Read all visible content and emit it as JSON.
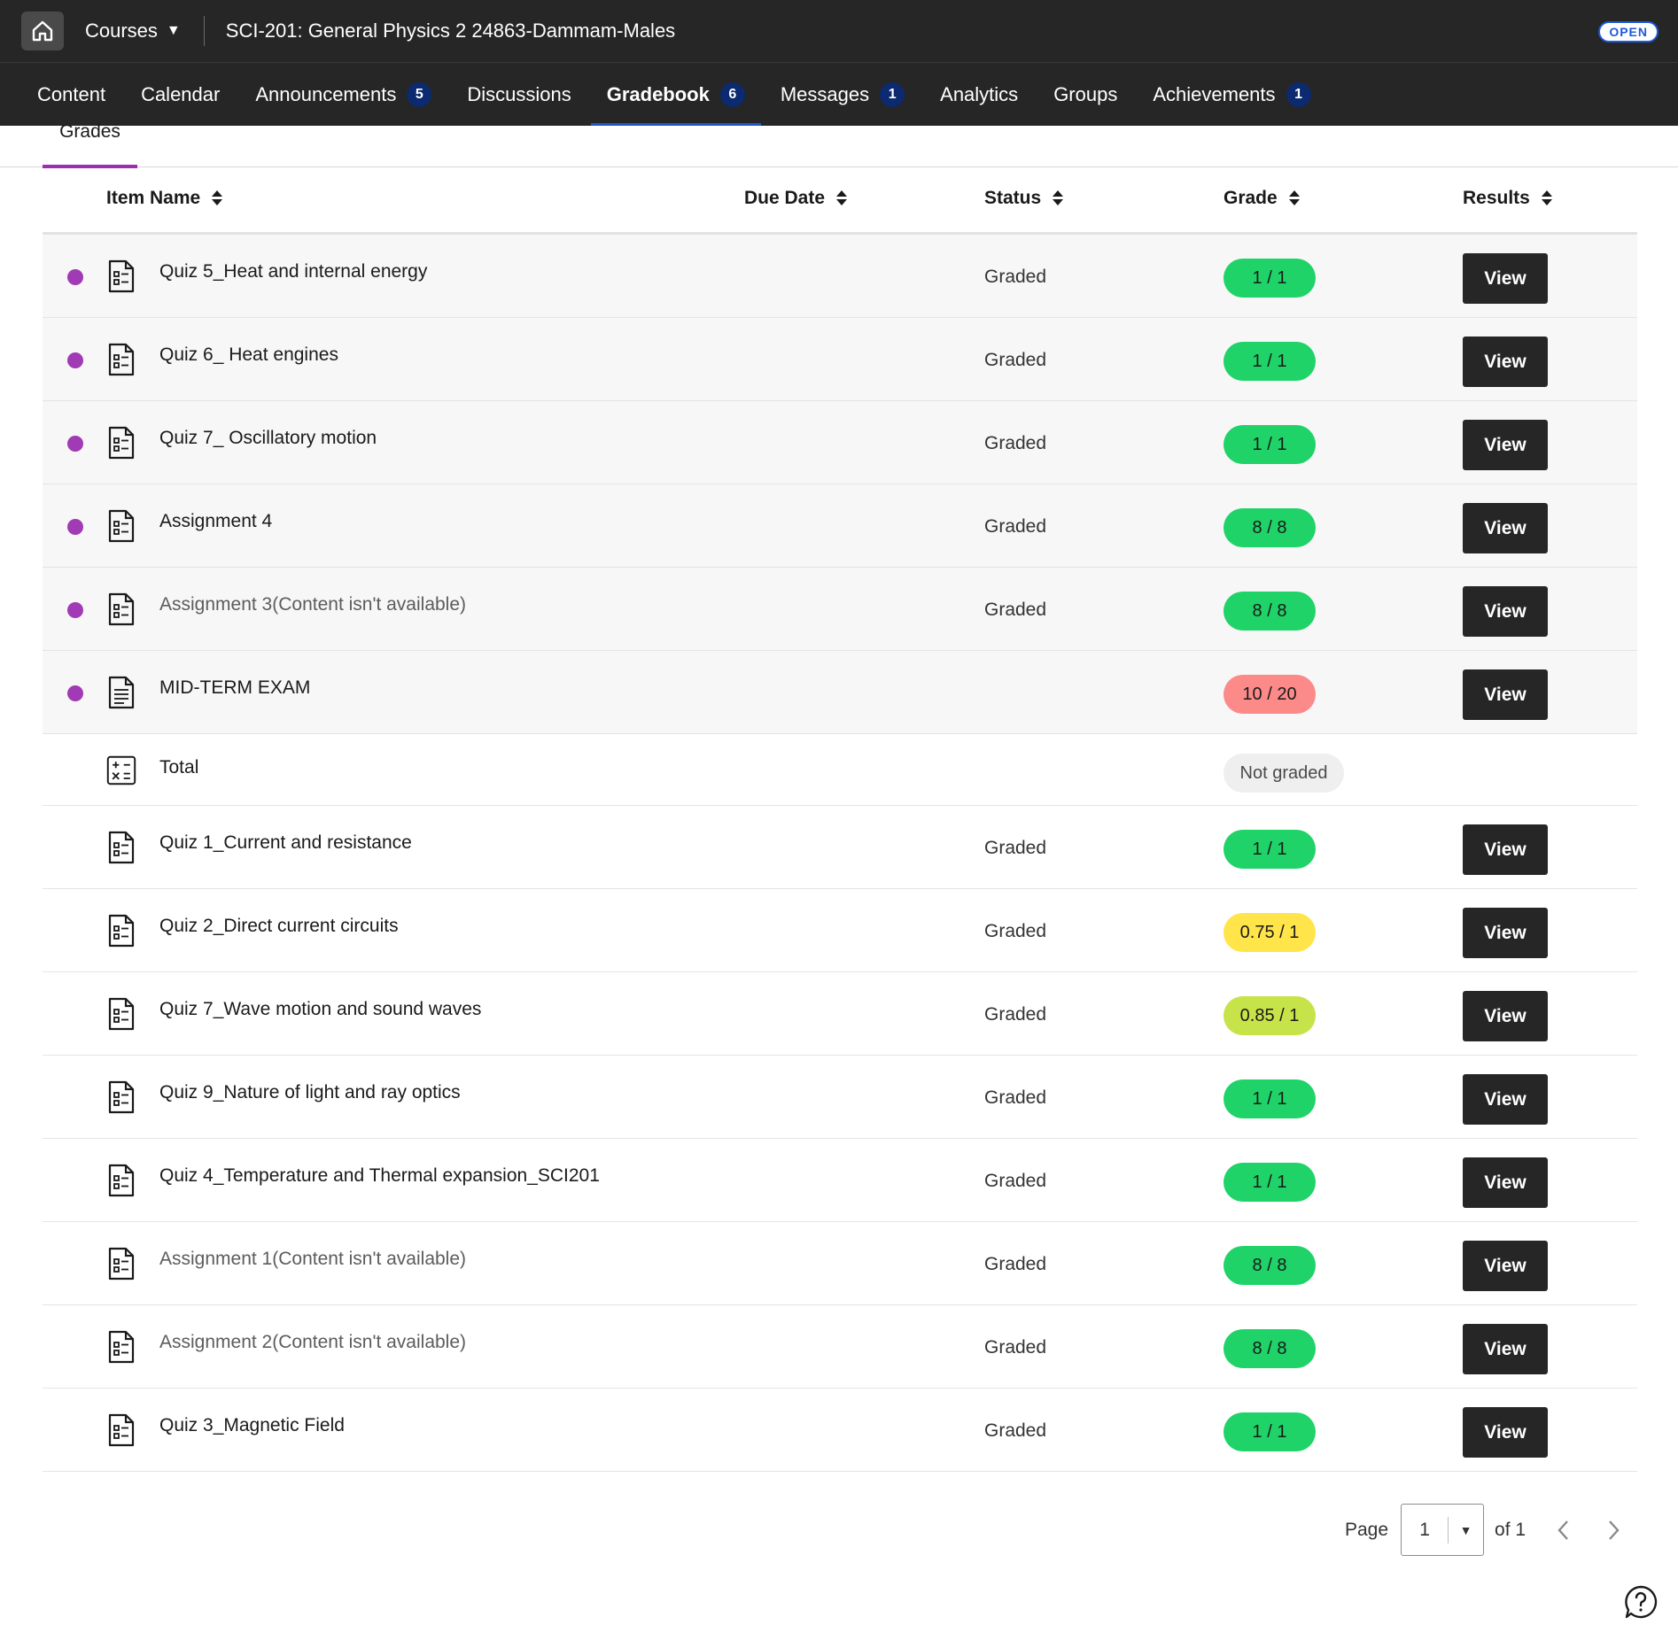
{
  "topbar": {
    "courses_label": "Courses",
    "course_title": "SCI-201: General Physics 2 24863-Dammam-Males",
    "open_badge": "OPEN"
  },
  "nav": {
    "tabs": [
      {
        "label": "Content",
        "badge": null
      },
      {
        "label": "Calendar",
        "badge": null
      },
      {
        "label": "Announcements",
        "badge": "5"
      },
      {
        "label": "Discussions",
        "badge": null
      },
      {
        "label": "Gradebook",
        "badge": "6",
        "active": true
      },
      {
        "label": "Messages",
        "badge": "1"
      },
      {
        "label": "Analytics",
        "badge": null
      },
      {
        "label": "Groups",
        "badge": null
      },
      {
        "label": "Achievements",
        "badge": "1"
      }
    ]
  },
  "subtab": {
    "label": "Grades"
  },
  "table": {
    "headers": {
      "item_name": "Item Name",
      "due_date": "Due Date",
      "status": "Status",
      "grade": "Grade",
      "results": "Results"
    },
    "rows": [
      {
        "name": "Quiz 5_Heat and internal energy",
        "status": "Graded",
        "grade": "1 / 1",
        "grade_color": "#1fd368",
        "new": true,
        "view": "View"
      },
      {
        "name": "Quiz 6_ Heat engines",
        "status": "Graded",
        "grade": "1 / 1",
        "grade_color": "#1fd368",
        "new": true,
        "view": "View"
      },
      {
        "name": "Quiz 7_ Oscillatory motion",
        "status": "Graded",
        "grade": "1 / 1",
        "grade_color": "#1fd368",
        "new": true,
        "view": "View"
      },
      {
        "name": "Assignment 4",
        "status": "Graded",
        "grade": "8 / 8",
        "grade_color": "#1fd368",
        "new": true,
        "view": "View"
      },
      {
        "name": "Assignment 3(Content isn't available)",
        "status": "Graded",
        "grade": "8 / 8",
        "grade_color": "#1fd368",
        "new": true,
        "view": "View"
      },
      {
        "name": "MID-TERM EXAM",
        "status": "",
        "grade": "10 / 20",
        "grade_color": "#fb8a89",
        "new": true,
        "view": "View"
      },
      {
        "name": "Total",
        "status": "",
        "grade": "Not graded",
        "grade_color": "#efefef",
        "new": false,
        "view": ""
      },
      {
        "name": "Quiz 1_Current and resistance",
        "status": "Graded",
        "grade": "1 / 1",
        "grade_color": "#1fd368",
        "new": false,
        "view": "View"
      },
      {
        "name": "Quiz 2_Direct current circuits",
        "status": "Graded",
        "grade": "0.75 / 1",
        "grade_color": "#ffe44a",
        "new": false,
        "view": "View"
      },
      {
        "name": "Quiz 7_Wave motion and sound waves",
        "status": "Graded",
        "grade": "0.85 / 1",
        "grade_color": "#c7e34a",
        "new": false,
        "view": "View"
      },
      {
        "name": "Quiz 9_Nature of light and ray optics",
        "status": "Graded",
        "grade": "1 / 1",
        "grade_color": "#1fd368",
        "new": false,
        "view": "View"
      },
      {
        "name": "Quiz 4_Temperature and Thermal expansion_SCI201",
        "status": "Graded",
        "grade": "1 / 1",
        "grade_color": "#1fd368",
        "new": false,
        "view": "View"
      },
      {
        "name": "Assignment 1(Content isn't available)",
        "status": "Graded",
        "grade": "8 / 8",
        "grade_color": "#1fd368",
        "new": false,
        "view": "View"
      },
      {
        "name": "Assignment 2(Content isn't available)",
        "status": "Graded",
        "grade": "8 / 8",
        "grade_color": "#1fd368",
        "new": false,
        "view": "View"
      },
      {
        "name": "Quiz 3_Magnetic Field",
        "status": "Graded",
        "grade": "1 / 1",
        "grade_color": "#1fd368",
        "new": false,
        "view": "View"
      }
    ]
  },
  "pagination": {
    "page_label": "Page",
    "current_page": "1",
    "of_label": "of 1"
  },
  "icons": {
    "home": "home-icon",
    "quiz": "quiz-document-icon",
    "exam": "document-icon",
    "total": "calculator-icon",
    "prev": "chevron-left-icon",
    "next": "chevron-right-icon",
    "help": "help-icon"
  },
  "colors": {
    "new_dot": "#a13ab5",
    "active_tab_underline": "#2457c5",
    "badge_bg": "#0b2a6f"
  }
}
